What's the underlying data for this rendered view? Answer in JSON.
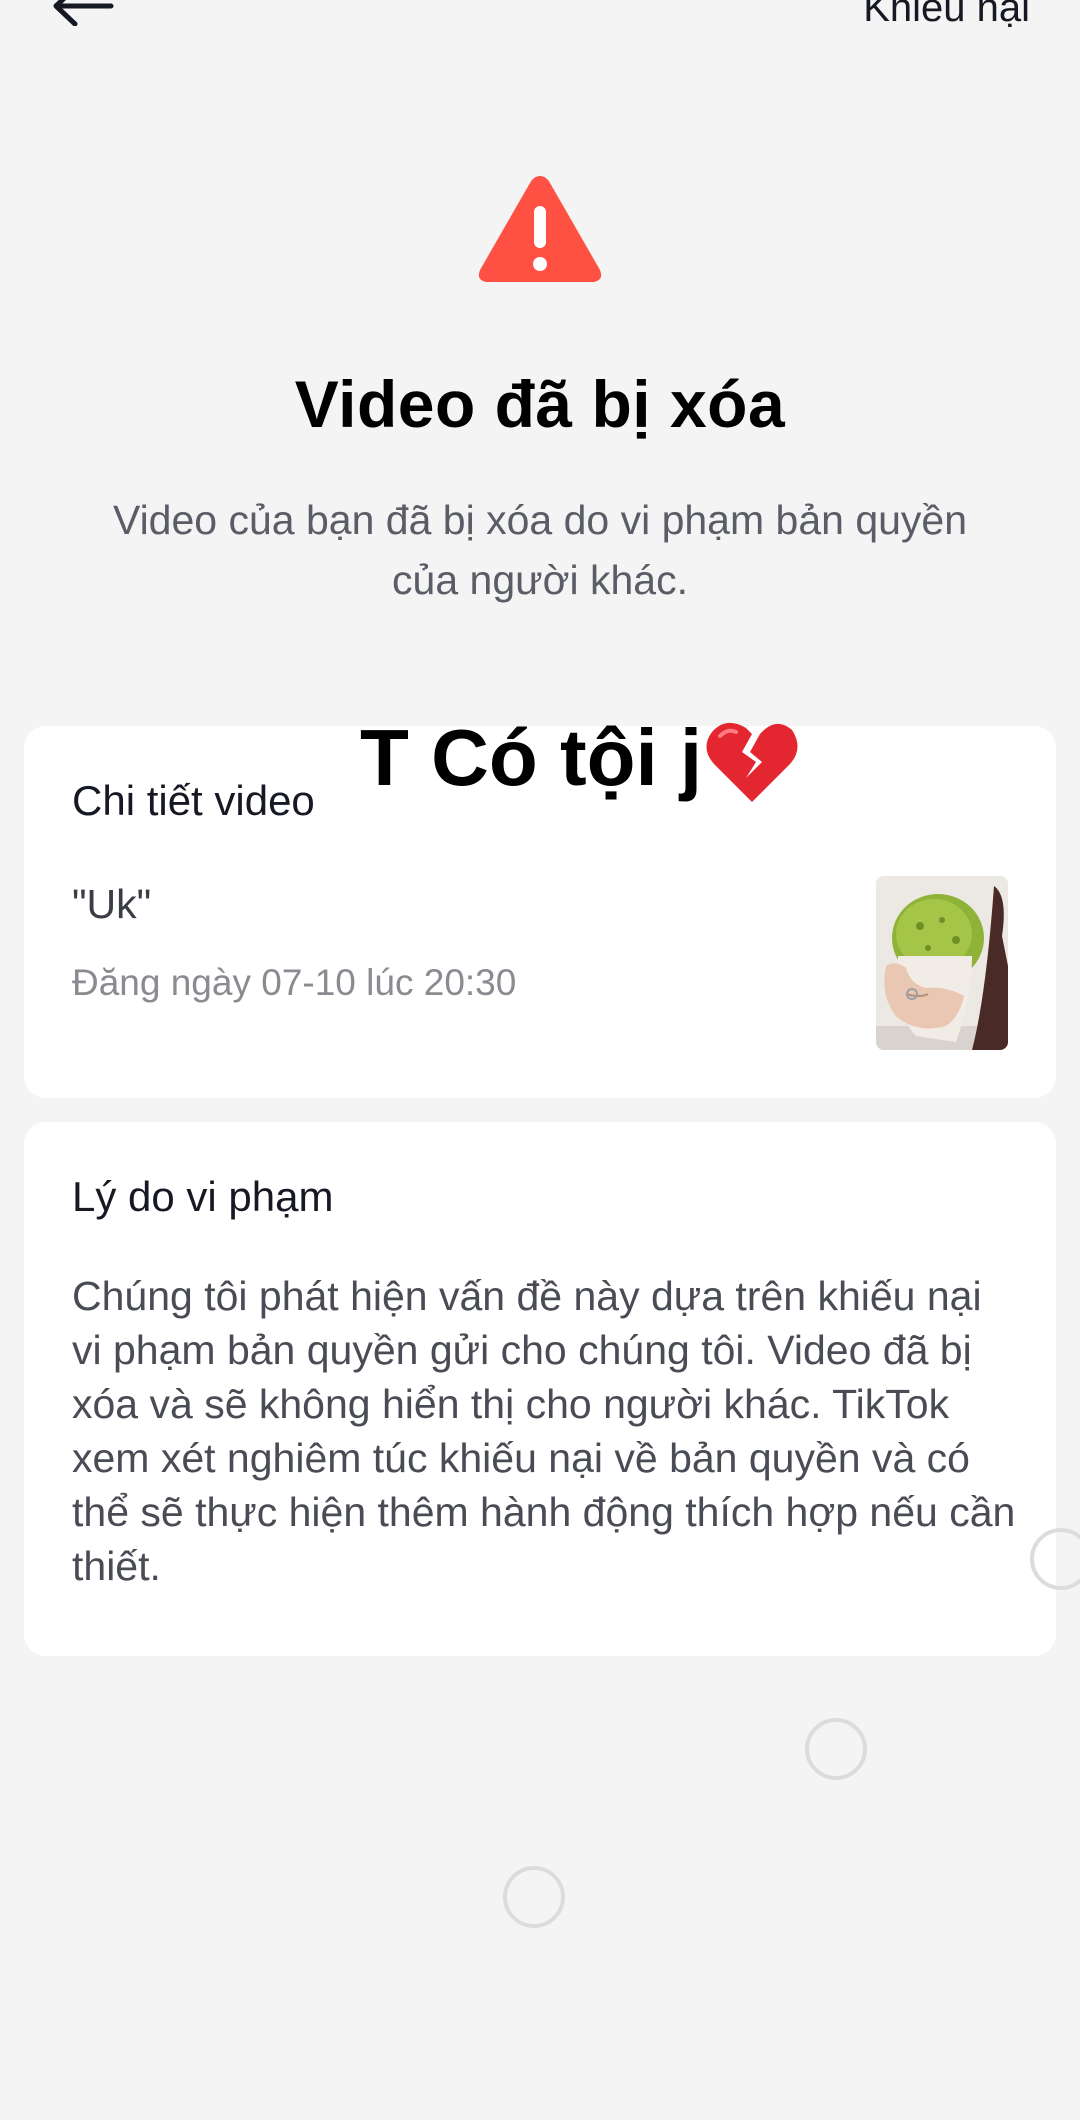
{
  "header": {
    "appeal_label": "Khiếu nại"
  },
  "notice": {
    "title": "Video đã bị xóa",
    "subtitle": "Video của bạn đã bị xóa do vi phạm bản quyền của người khác."
  },
  "video_details": {
    "heading": "Chi tiết video",
    "caption": "\"Uk\"",
    "posted": "Đăng ngày 07-10 lúc 20:30"
  },
  "violation": {
    "heading": "Lý do vi phạm",
    "body": "Chúng tôi phát hiện vấn đề này dựa trên khiếu nại vi phạm bản quyền gửi cho chúng tôi. Video đã bị xóa và sẽ không hiển thị cho người khác. TikTok xem xét nghiêm túc khiếu nại về bản quyền và có thể sẽ thực hiện thêm hành động thích hợp nếu cần thiết."
  },
  "overlay": {
    "text": "T Có tội j"
  },
  "icons": {
    "back": "back-arrow-icon",
    "warning": "warning-triangle-icon",
    "overlay_emoji": "broken-heart-icon"
  },
  "colors": {
    "warning_red": "#fe5144",
    "background": "#f4f4f4",
    "card": "#ffffff"
  }
}
